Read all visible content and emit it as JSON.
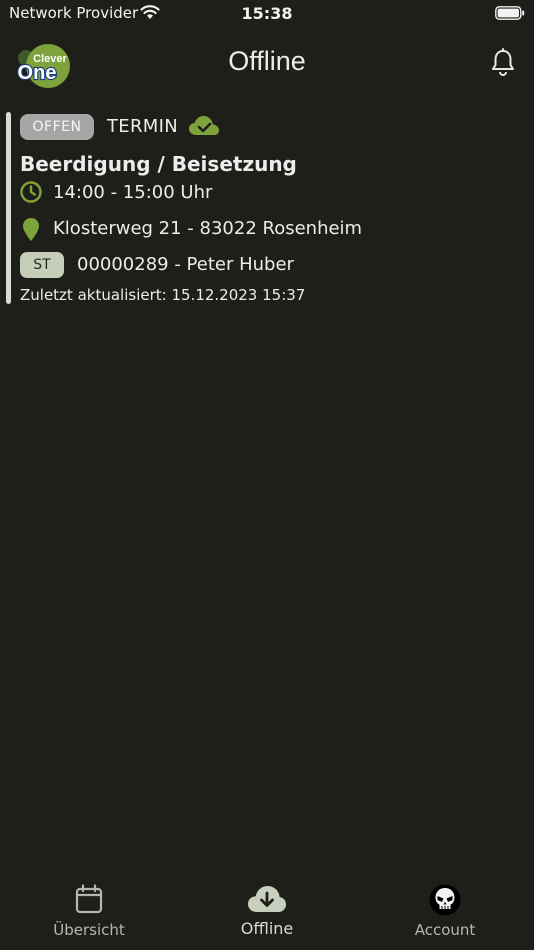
{
  "status_bar": {
    "carrier": "Network Provider",
    "time": "15:38"
  },
  "header": {
    "logo_text_top": "Clever",
    "logo_text_bottom": "One",
    "title": "Offline"
  },
  "appointment": {
    "status": "OFFEN",
    "type": "TERMIN",
    "sync_icon": "cloud-check-icon",
    "title": "Beerdigung / Beisetzung",
    "time": "14:00 - 15:00 Uhr",
    "location": "Klosterweg 21 - 83022 Rosenheim",
    "ref_badge": "ST",
    "ref_text": "00000289 - Peter Huber",
    "updated": "Zuletzt aktualisiert: 15.12.2023 15:37"
  },
  "tabs": [
    {
      "label": "Übersicht",
      "icon": "calendar-icon"
    },
    {
      "label": "Offline",
      "icon": "cloud-download-icon",
      "active": true
    },
    {
      "label": "Account",
      "icon": "skull-avatar-icon"
    }
  ],
  "colors": {
    "background": "#1f1f1a",
    "accent_green": "#7ea33a",
    "badge_offen": "#a6a6a6",
    "badge_st": "#c6cdb8"
  }
}
